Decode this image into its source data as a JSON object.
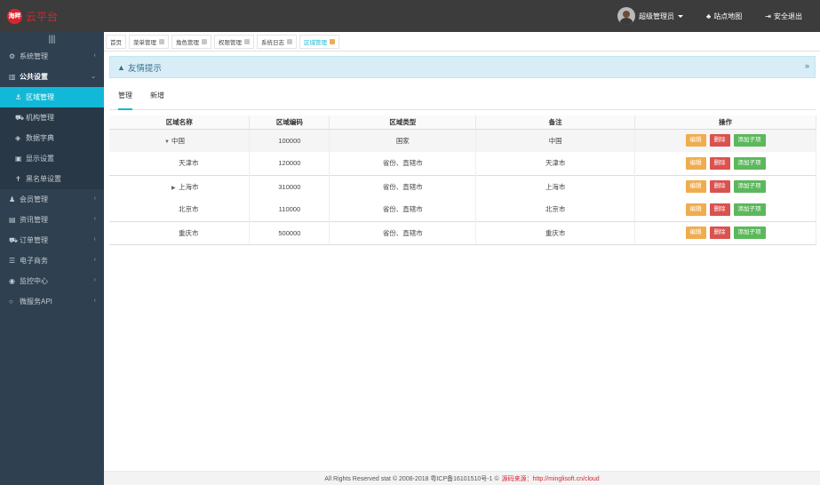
{
  "brand": {
    "logo_text": "海畔",
    "name": "云平台"
  },
  "topbar": {
    "user_name": "超级管理员",
    "sitemap": "站点地图",
    "logout": "安全退出"
  },
  "sidebar": {
    "toggle_icon": "menu-icon",
    "items": [
      {
        "label": "系统管理",
        "icon": "cogs-icon"
      },
      {
        "label": "公共设置",
        "icon": "bank-icon"
      },
      {
        "label": "会员管理",
        "icon": "user-icon"
      },
      {
        "label": "资讯管理",
        "icon": "file-icon"
      },
      {
        "label": "订单管理",
        "icon": "car-icon"
      },
      {
        "label": "电子商务",
        "icon": "list-icon"
      },
      {
        "label": "监控中心",
        "icon": "eye-icon"
      },
      {
        "label": "微服务API",
        "icon": "circle-icon"
      }
    ],
    "sub_items": [
      {
        "label": "区域管理",
        "icon": "anchor-icon"
      },
      {
        "label": "机构管理",
        "icon": "car-icon"
      },
      {
        "label": "数据字典",
        "icon": "cube-icon"
      },
      {
        "label": "显示设置",
        "icon": "monitor-icon"
      },
      {
        "label": "黑名单设置",
        "icon": "pushpin-icon"
      }
    ]
  },
  "tabs": [
    "首页",
    "菜单管理",
    "角色管理",
    "权限管理",
    "系统日志",
    "区域管理"
  ],
  "alert": {
    "text": "友情提示"
  },
  "inner_tabs": [
    "管理",
    "新增"
  ],
  "table": {
    "headers": [
      "区域名称",
      "区域编码",
      "区域类型",
      "备注",
      "操作"
    ],
    "actions": {
      "edit": "编辑",
      "delete": "删除",
      "add_child": "添加子项"
    },
    "rows": [
      {
        "toggle": "▼",
        "name": "中国",
        "code": "100000",
        "type": "国家",
        "note": "中国"
      },
      {
        "toggle": "",
        "name": "天津市",
        "code": "120000",
        "type": "省份、直辖市",
        "note": "天津市"
      },
      {
        "toggle": "▶",
        "name": "上海市",
        "code": "310000",
        "type": "省份、直辖市",
        "note": "上海市"
      },
      {
        "toggle": "",
        "name": "北京市",
        "code": "110000",
        "type": "省份、直辖市",
        "note": "北京市"
      },
      {
        "toggle": "",
        "name": "重庆市",
        "code": "500000",
        "type": "省份、直辖市",
        "note": "重庆市"
      }
    ]
  },
  "footer": {
    "text": "All Rights Reserved stat © 2008-2018 粤ICP备16101510号-1 ©",
    "source": "源码来源：http://minglisoft.cn/cloud"
  }
}
